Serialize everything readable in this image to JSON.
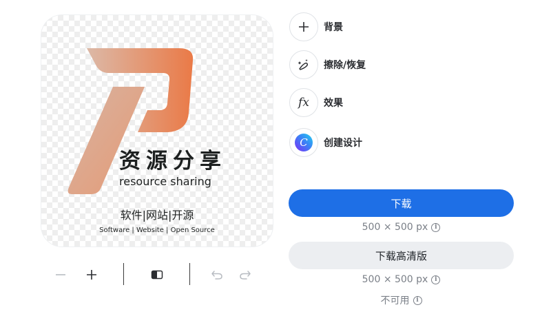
{
  "preview": {
    "brand_title": "资源分享",
    "brand_subtitle": "resource sharing",
    "brand_categories": "软件|网站|开源",
    "brand_categories_en": "Software | Website | Open Source",
    "logo_colors": {
      "start": "#ddb7a4",
      "end": "#ea7a47"
    }
  },
  "toolbar": {
    "icons": [
      "zoom-out-icon",
      "zoom-in-icon",
      "compare-icon",
      "undo-icon",
      "redo-icon"
    ]
  },
  "tools": [
    {
      "label": "背景",
      "icon": "plus-icon"
    },
    {
      "label": "擦除/恢复",
      "icon": "magic-brush-icon"
    },
    {
      "label": "效果",
      "icon": "fx-icon",
      "glyph": "fx"
    },
    {
      "label": "创建设计",
      "icon": "canva-logo-icon",
      "glyph": "C"
    }
  ],
  "download": {
    "primary_label": "下载",
    "primary_size": "500 × 500 px",
    "hd_label": "下载高清版",
    "hd_size": "500 × 500 px",
    "hd_status": "不可用",
    "info_glyph": "i"
  },
  "colors": {
    "primary": "#1e6fe6",
    "secondary": "#eceef1",
    "muted": "#7a7f87"
  }
}
